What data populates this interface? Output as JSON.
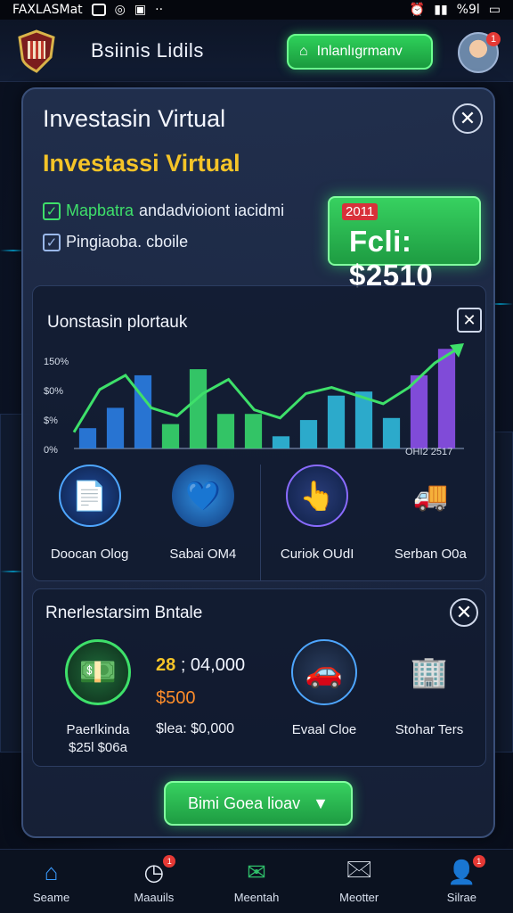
{
  "status_bar": {
    "app_name": "FAXLASMat",
    "battery": "%9l"
  },
  "header": {
    "title": "Bsiinis Lidils",
    "button_label": "Inlanlıgrmanv",
    "avatar_badge": "1"
  },
  "panel": {
    "title": "Investasin Virtual",
    "subtitle": "Investassi Virtual",
    "checks": [
      {
        "label_highlight": "Mapbatra",
        "label_rest": "andadvioiont iacidmi",
        "checked": true
      },
      {
        "label_highlight": "",
        "label_rest": "Pingiaoba. cboile",
        "checked": true
      }
    ],
    "price_card": {
      "year": "2011",
      "value": "Fcli: $2510"
    }
  },
  "chart": {
    "title": "Uonstasin plortauk",
    "x_label": "OHI2 2517"
  },
  "chart_data": {
    "type": "bar",
    "title": "Uonstasin plortauk",
    "xlabel": "OHI2 2517",
    "ylabel": "",
    "y_ticks": [
      "150%",
      "$0%",
      "$%",
      "0%"
    ],
    "values": [
      1,
      2,
      3.6,
      1.2,
      3.9,
      1.7,
      1.7,
      0.6,
      1.4,
      2.6,
      2.8,
      1.5,
      3.6,
      4.9
    ],
    "trend": [
      0.8,
      2.9,
      3.6,
      2.0,
      1.6,
      2.7,
      3.4,
      1.9,
      1.5,
      2.7,
      3.0,
      2.6,
      2.2,
      3.0,
      4.2,
      5.0
    ],
    "colors": [
      "#2a7ce0",
      "#2fb6d8",
      "#36d26a",
      "#8a4fe6"
    ]
  },
  "features": [
    {
      "label": "Doocan Olog",
      "icon": "document-icon"
    },
    {
      "label": "Sabai OM4",
      "icon": "heart-chart-icon"
    },
    {
      "label": "Curiok OUdI",
      "icon": "tablet-click-icon"
    },
    {
      "label": "Serban O0a",
      "icon": "truck-boxes-icon"
    }
  ],
  "invest": {
    "title": "Rnerlestarsim Bntale",
    "items": [
      {
        "label1": "Paerlkinda",
        "label2": "$25l $06a",
        "icon": "money-card-icon"
      },
      {
        "label1": "Evaal Cloe",
        "label2": "",
        "icon": "car-icon"
      },
      {
        "label1": "Stohar Ters",
        "label2": "",
        "icon": "building-network-icon"
      }
    ],
    "mid": {
      "v1_green": "28",
      "v1_rest": "; 04,000",
      "v2": "$500",
      "v3": "$lea: $0,000"
    }
  },
  "cta_label": "Bimi Goea lioav",
  "bottom_nav": [
    {
      "label": "Seame",
      "icon": "home-icon",
      "badge": ""
    },
    {
      "label": "Maauils",
      "icon": "stopwatch-icon",
      "badge": "1"
    },
    {
      "label": "Meentah",
      "icon": "mail-open-icon",
      "badge": ""
    },
    {
      "label": "Meotter",
      "icon": "inbox-icon",
      "badge": ""
    },
    {
      "label": "Silrae",
      "icon": "user-icon",
      "badge": "1"
    }
  ]
}
